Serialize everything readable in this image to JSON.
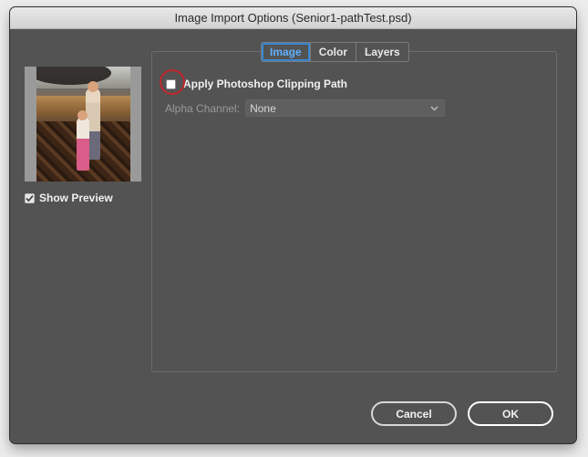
{
  "window": {
    "title": "Image Import Options (Senior1-pathTest.psd)"
  },
  "preview": {
    "show_preview_label": "Show Preview",
    "show_preview_checked": true
  },
  "tabs": [
    {
      "label": "Image",
      "active": true
    },
    {
      "label": "Color",
      "active": false
    },
    {
      "label": "Layers",
      "active": false
    }
  ],
  "image_tab": {
    "clipping_path_label": "Apply Photoshop Clipping Path",
    "clipping_path_checked": false,
    "alpha_channel_label": "Alpha Channel:",
    "alpha_channel_value": "None"
  },
  "buttons": {
    "cancel": "Cancel",
    "ok": "OK"
  },
  "icons": {
    "checkmark": "checkmark-icon",
    "dropdown": "chevron-down-icon",
    "highlight": "red-circle-annotation"
  },
  "colors": {
    "dialog_bg": "#535353",
    "accent": "#3a87d0",
    "annotation": "#c0272d"
  }
}
